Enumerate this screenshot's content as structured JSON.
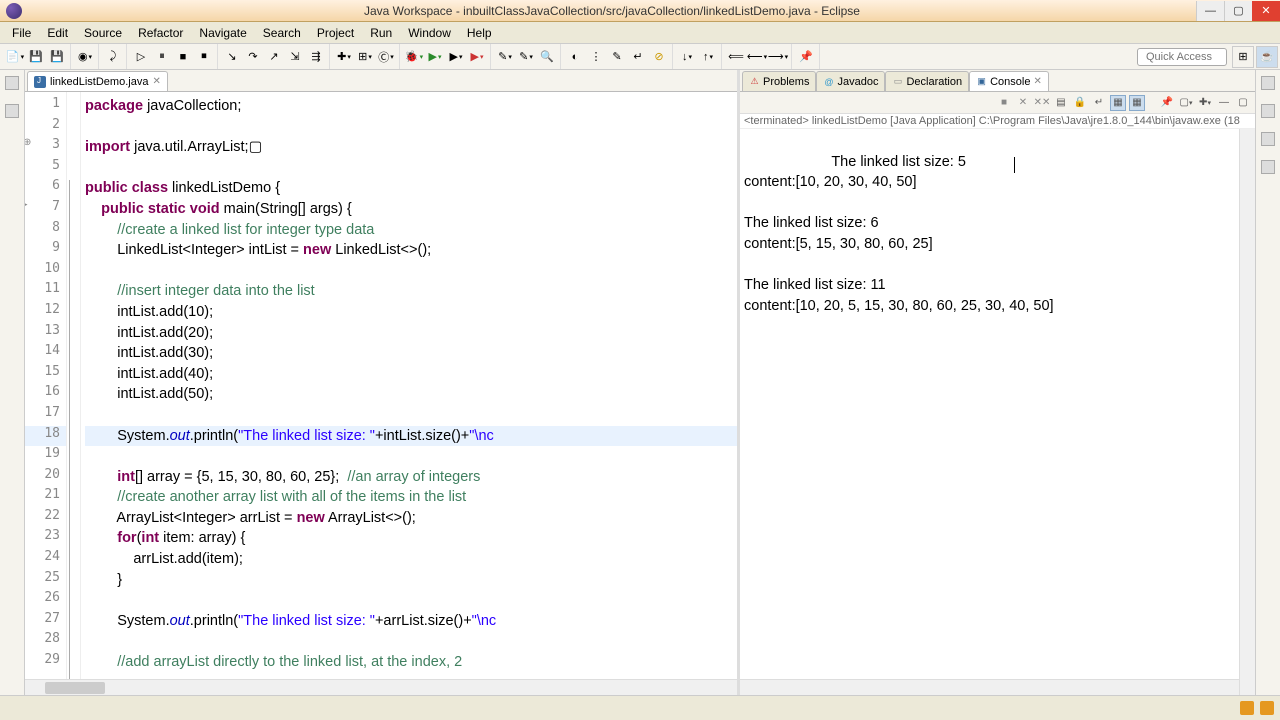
{
  "window": {
    "title": "Java Workspace - inbuiltClassJavaCollection/src/javaCollection/linkedListDemo.java - Eclipse"
  },
  "menus": [
    "File",
    "Edit",
    "Source",
    "Refactor",
    "Navigate",
    "Search",
    "Project",
    "Run",
    "Window",
    "Help"
  ],
  "quick_access": "Quick Access",
  "editor_tab": {
    "label": "linkedListDemo.java"
  },
  "code": {
    "lines": [
      {
        "n": 1,
        "html": "<span class='kw'>package</span> javaCollection;"
      },
      {
        "n": 2,
        "html": ""
      },
      {
        "n": 3,
        "html": "<span class='kw'>import</span> java.util.ArrayList;▢"
      },
      {
        "n": 5,
        "html": ""
      },
      {
        "n": 6,
        "html": "<span class='kw'>public</span> <span class='kw'>class</span> linkedListDemo {"
      },
      {
        "n": 7,
        "html": "    <span class='kw'>public</span> <span class='kw'>static</span> <span class='kw'>void</span> main(String[] args) {"
      },
      {
        "n": 8,
        "html": "        <span class='cm'>//create a linked list for integer type data</span>"
      },
      {
        "n": 9,
        "html": "        LinkedList&lt;Integer&gt; intList = <span class='kw'>new</span> LinkedList&lt;&gt;();"
      },
      {
        "n": 10,
        "html": ""
      },
      {
        "n": 11,
        "html": "        <span class='cm'>//insert integer data into the list</span>"
      },
      {
        "n": 12,
        "html": "        intList.add(10);"
      },
      {
        "n": 13,
        "html": "        intList.add(20);"
      },
      {
        "n": 14,
        "html": "        intList.add(30);"
      },
      {
        "n": 15,
        "html": "        intList.add(40);"
      },
      {
        "n": 16,
        "html": "        intList.add(50);"
      },
      {
        "n": 17,
        "html": ""
      },
      {
        "n": 18,
        "html": "        System.<span class='it'>out</span>.println(<span class='str'>\"The linked list size: \"</span>+intList.size()+<span class='str'>\"\\nc</span>",
        "hl": true
      },
      {
        "n": 19,
        "html": ""
      },
      {
        "n": 20,
        "html": "        <span class='kw'>int</span>[] array = {5, 15, 30, 80, 60, 25};  <span class='cm'>//an array of integers</span>"
      },
      {
        "n": 21,
        "html": "        <span class='cm'>//create another array list with all of the items in the list</span>"
      },
      {
        "n": 22,
        "html": "        ArrayList&lt;Integer&gt; arrList = <span class='kw'>new</span> ArrayList&lt;&gt;();"
      },
      {
        "n": 23,
        "html": "        <span class='kw'>for</span>(<span class='kw'>int</span> item: array) {"
      },
      {
        "n": 24,
        "html": "            arrList.add(item);"
      },
      {
        "n": 25,
        "html": "        }"
      },
      {
        "n": 26,
        "html": ""
      },
      {
        "n": 27,
        "html": "        System.<span class='it'>out</span>.println(<span class='str'>\"The linked list size: \"</span>+arrList.size()+<span class='str'>\"\\nc</span>"
      },
      {
        "n": 28,
        "html": ""
      },
      {
        "n": 29,
        "html": "        <span class='cm'>//add arrayList directly to the linked list, at the index, 2</span>"
      }
    ]
  },
  "view_tabs": [
    {
      "label": "Problems",
      "icon": "⚠",
      "color": "#c33"
    },
    {
      "label": "Javadoc",
      "icon": "@",
      "color": "#39c"
    },
    {
      "label": "Declaration",
      "icon": "▭",
      "color": "#888"
    },
    {
      "label": "Console",
      "icon": "▣",
      "color": "#369",
      "active": true
    }
  ],
  "console": {
    "info": "<terminated> linkedListDemo [Java Application] C:\\Program Files\\Java\\jre1.8.0_144\\bin\\javaw.exe (18",
    "output": "The linked list size: 5\ncontent:[10, 20, 30, 40, 50]\n\nThe linked list size: 6\ncontent:[5, 15, 30, 80, 60, 25]\n\nThe linked list size: 11\ncontent:[10, 20, 5, 15, 30, 80, 60, 25, 30, 40, 50]"
  }
}
